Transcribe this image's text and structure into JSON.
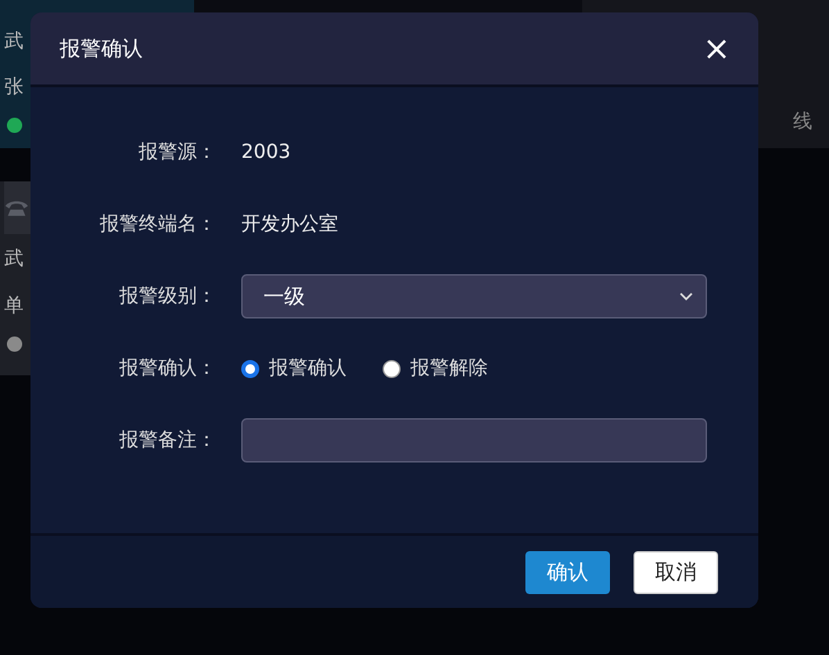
{
  "background_cards": [
    {
      "kind": "online",
      "lines": [
        "武",
        "张"
      ],
      "color": "#1fa855"
    },
    {
      "kind": "phone",
      "lines": [
        "武",
        "单"
      ],
      "color": "#8a8a8a"
    }
  ],
  "background_right": {
    "text": "线"
  },
  "dialog": {
    "title": "报警确认",
    "close": "×",
    "fields": [
      {
        "kind": "text",
        "label": "报警源：",
        "value": "2003"
      },
      {
        "kind": "text",
        "label": "报警终端名：",
        "value": "开发办公室"
      },
      {
        "kind": "select",
        "label": "报警级别：",
        "value": "一级"
      },
      {
        "kind": "radio",
        "label": "报警确认：",
        "options": [
          {
            "label": "报警确认",
            "selected": true
          },
          {
            "label": "报警解除",
            "selected": false
          }
        ]
      },
      {
        "kind": "input",
        "label": "报警备注："
      }
    ],
    "buttons": [
      {
        "kind": "primary",
        "label": "确认"
      },
      {
        "kind": "default",
        "label": "取消"
      }
    ]
  }
}
